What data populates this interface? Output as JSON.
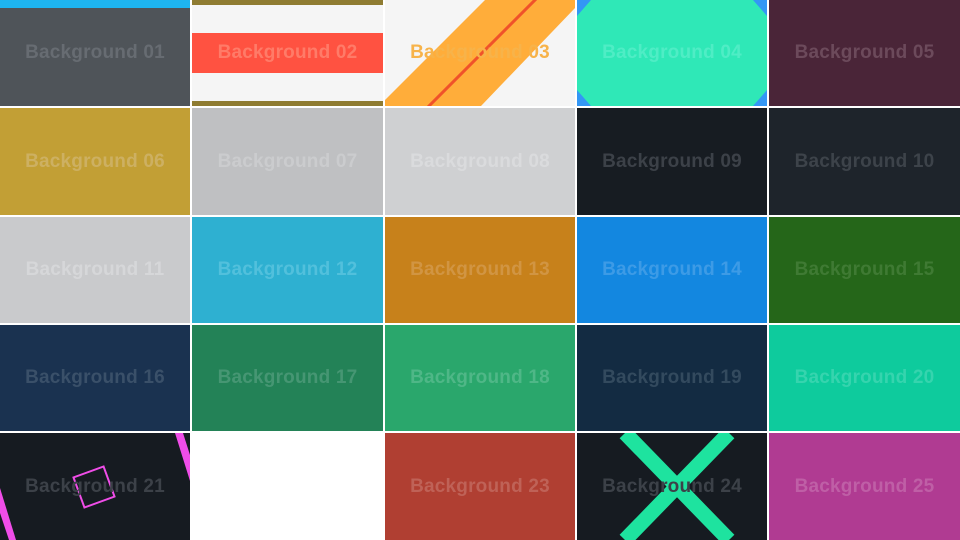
{
  "tiles": [
    {
      "label": "Background 01",
      "bg": "#4f5459",
      "fg": "#676c72"
    },
    {
      "label": "Background 02",
      "bg": "#f5f5f5",
      "fg": "#ff7b68",
      "accent": "#ff5241",
      "stripe": "#8f7c32"
    },
    {
      "label": "Background 03",
      "bg": "#f5f5f5",
      "fg": "#f7b34a",
      "accent": "#ffad3a",
      "line": "#f0522a"
    },
    {
      "label": "Background 04",
      "bg": "#2fe8b7",
      "fg": "#4fedc5",
      "accent": "#3397f5"
    },
    {
      "label": "Background 05",
      "bg": "#4a2538",
      "fg": "#6c4a5b"
    },
    {
      "label": "Background 06",
      "bg": "#c29f35",
      "fg": "#cdb062"
    },
    {
      "label": "Background 07",
      "bg": "#bfc0c2",
      "fg": "#cbccce"
    },
    {
      "label": "Background 08",
      "bg": "#cfd0d2",
      "fg": "#dadbdd"
    },
    {
      "label": "Background 09",
      "bg": "#171c22",
      "fg": "#3c4148"
    },
    {
      "label": "Background 10",
      "bg": "#1e242b",
      "fg": "#3d434a"
    },
    {
      "label": "Background 11",
      "bg": "#c9cacc",
      "fg": "#d6d7d9"
    },
    {
      "label": "Background 12",
      "bg": "#2eb0d1",
      "fg": "#52c0dc"
    },
    {
      "label": "Background 13",
      "bg": "#c7811b",
      "fg": "#d19543"
    },
    {
      "label": "Background 14",
      "bg": "#1387e0",
      "fg": "#3d9be6"
    },
    {
      "label": "Background 15",
      "bg": "#256619",
      "fg": "#3f7a33"
    },
    {
      "label": "Background 16",
      "bg": "#1a3250",
      "fg": "#3a5069"
    },
    {
      "label": "Background 17",
      "bg": "#238257",
      "fg": "#469673"
    },
    {
      "label": "Background 18",
      "bg": "#2aa76c",
      "fg": "#4fb787"
    },
    {
      "label": "Background 19",
      "bg": "#132b42",
      "fg": "#334a5e"
    },
    {
      "label": "Background 20",
      "bg": "#0ecb9d",
      "fg": "#36d4ae"
    },
    {
      "label": "Background 21",
      "bg": "#161b21",
      "fg": "#3c4148",
      "accent": "#f04de8"
    },
    {
      "label": "",
      "bg": "#ffffff",
      "fg": "#ffffff",
      "empty": true
    },
    {
      "label": "Background 23",
      "bg": "#b03f32",
      "fg": "#bf6257"
    },
    {
      "label": "Background 24",
      "bg": "#161b21",
      "fg": "#3c4148",
      "accent": "#1ee39f"
    },
    {
      "label": "Background 25",
      "bg": "#b03b92",
      "fg": "#bf5fa6"
    }
  ],
  "top_bar_color": "#1eb5f0"
}
